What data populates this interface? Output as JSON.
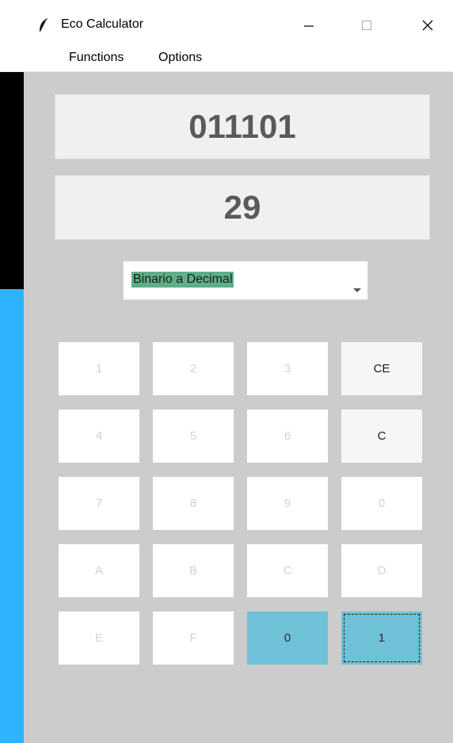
{
  "window": {
    "title": "Eco Calculator",
    "controls": {
      "minimize": "—",
      "maximize": "☐",
      "close": "✕"
    }
  },
  "menu": {
    "functions": "Functions",
    "options": "Options"
  },
  "display": {
    "input": "011101",
    "output": "29"
  },
  "conversion": {
    "selected": "Binario a Decimal"
  },
  "keypad": {
    "k1": "1",
    "k2": "2",
    "k3": "3",
    "ce": "CE",
    "k4": "4",
    "k5": "5",
    "k6": "6",
    "c": "C",
    "k7": "7",
    "k8": "8",
    "k9": "9",
    "k0": "0",
    "kA": "A",
    "kB": "B",
    "kC": "C",
    "kD": "D",
    "kE": "E",
    "kF": "F",
    "bin0": "0",
    "bin1": "1"
  },
  "colors": {
    "accent_key": "#6ec1d6",
    "window_bg": "#cccccc",
    "selection": "#5fae87",
    "desktop_blue": "#2db3ff"
  }
}
